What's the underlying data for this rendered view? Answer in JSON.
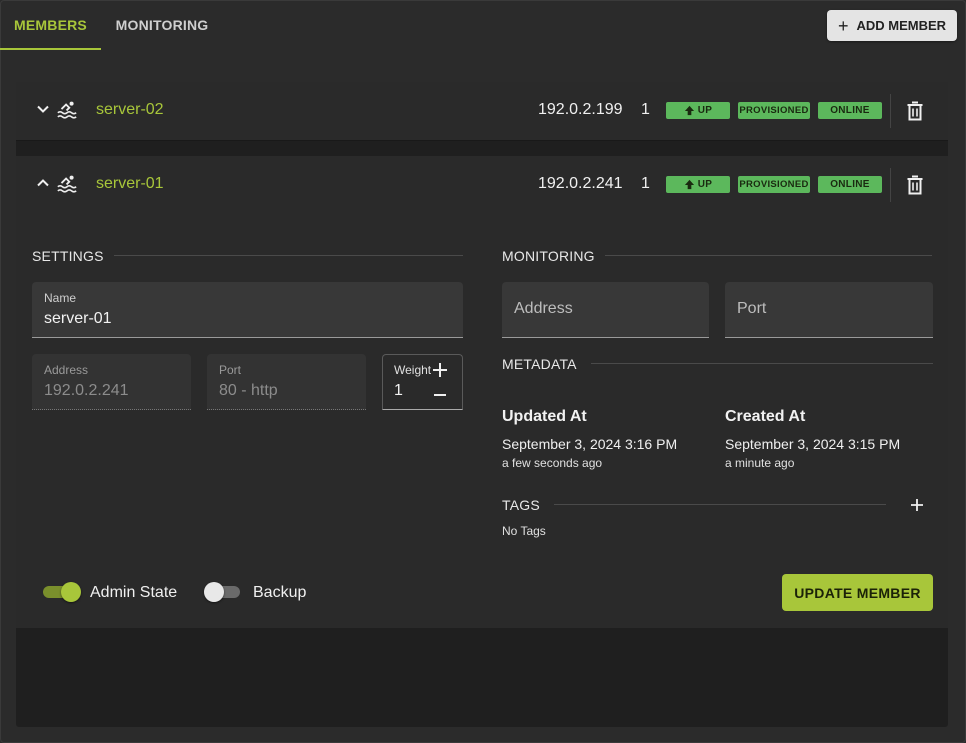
{
  "tabs": [
    {
      "label": "MEMBERS",
      "active": true
    },
    {
      "label": "MONITORING",
      "active": false
    }
  ],
  "add_member_label": "ADD MEMBER",
  "members": [
    {
      "name": "server-02",
      "ip": "192.0.2.199",
      "weight": "1",
      "status_up": "UP",
      "status_provisioned": "PROVISIONED",
      "status_online": "ONLINE",
      "expanded": false
    },
    {
      "name": "server-01",
      "ip": "192.0.2.241",
      "weight": "1",
      "status_up": "UP",
      "status_provisioned": "PROVISIONED",
      "status_online": "ONLINE",
      "expanded": true
    }
  ],
  "details": {
    "settings_title": "SETTINGS",
    "name_label": "Name",
    "name_value": "server-01",
    "address_label": "Address",
    "address_value": "192.0.2.241",
    "port_label": "Port",
    "port_value": "80 - http",
    "weight_label": "Weight",
    "weight_value": "1",
    "monitoring_title": "MONITORING",
    "mon_address_placeholder": "Address",
    "mon_port_placeholder": "Port",
    "metadata_title": "METADATA",
    "updated_label": "Updated At",
    "updated_date": "September 3, 2024 3:16 PM",
    "updated_relative": "a few seconds ago",
    "created_label": "Created At",
    "created_date": "September 3, 2024 3:15 PM",
    "created_relative": "a minute ago",
    "tags_title": "TAGS",
    "tags_empty": "No Tags",
    "admin_state_label": "Admin State",
    "admin_state_on": true,
    "backup_label": "Backup",
    "backup_on": false,
    "update_button": "UPDATE MEMBER"
  },
  "colors": {
    "accent": "#a8c63a",
    "status_green": "#5cb85c",
    "background": "#2b2b2b"
  }
}
